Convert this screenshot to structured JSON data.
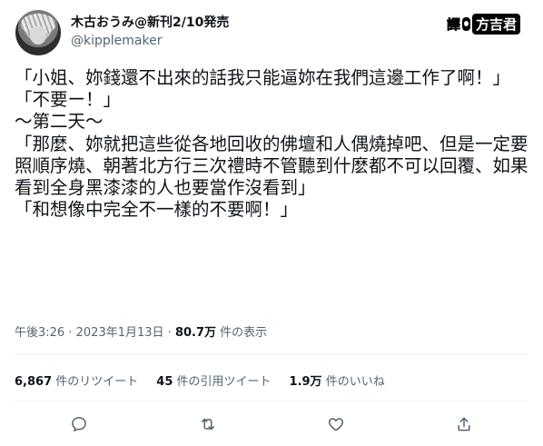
{
  "author": {
    "display_name": "木古おうみ@新刊2/10発売",
    "handle": "@kipplemaker"
  },
  "translator_stamp": {
    "prefix": "譯",
    "name": "方吉君"
  },
  "tweet": {
    "lines": [
      "「小姐、妳錢還不出來的話我只能逼妳在我們這邊工作了啊！」",
      "「不要ー！」",
      "～第二天～",
      "「那麼、妳就把這些從各地回收的佛壇和人偶燒掉吧、但是一定要照順序燒、朝著北方行三次禮時不管聽到什麽都不可以回覆、如果看到全身黑漆漆的人也要當作沒看到」",
      "「和想像中完全不一樣的不要啊！」"
    ]
  },
  "meta": {
    "time": "午後3:26",
    "dot1": "·",
    "date": "2023年1月13日",
    "dot2": "·",
    "views": "80.7万",
    "views_label": "件の表示"
  },
  "stats": {
    "retweets": "6,867",
    "retweets_label": "件のリツイート",
    "quotes": "45",
    "quotes_label": "件の引用ツイート",
    "likes": "1.9万",
    "likes_label": "件のいいね"
  },
  "actions": [
    {
      "icon": "reply-icon"
    },
    {
      "icon": "retweet-icon"
    },
    {
      "icon": "like-icon"
    },
    {
      "icon": "share-icon"
    }
  ]
}
